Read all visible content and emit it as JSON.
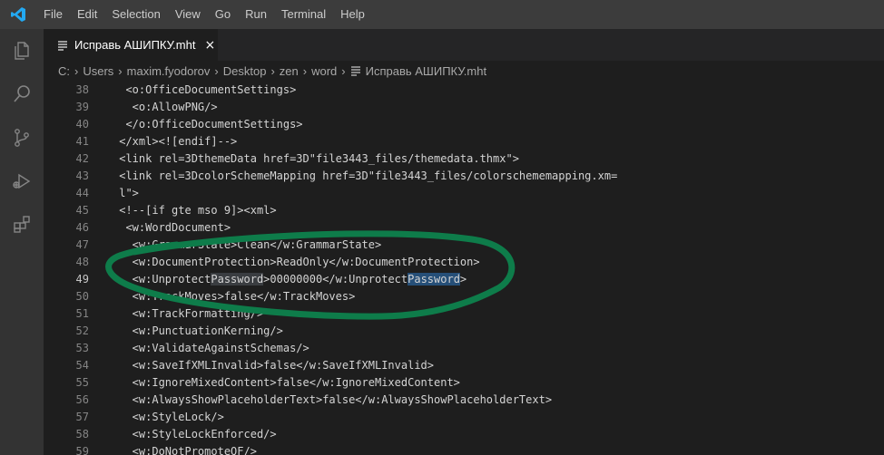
{
  "menu": [
    "File",
    "Edit",
    "Selection",
    "View",
    "Go",
    "Run",
    "Terminal",
    "Help"
  ],
  "tab": {
    "label": "Исправь АШИПКУ.mht",
    "close": "×"
  },
  "breadcrumb": [
    "C:",
    "Users",
    "maxim.fyodorov",
    "Desktop",
    "zen",
    "word",
    "Исправь АШИПКУ.mht"
  ],
  "editor": {
    "active_line": 49,
    "lines": [
      {
        "n": "38",
        "text": "  <o:OfficeDocumentSettings>"
      },
      {
        "n": "39",
        "text": "   <o:AllowPNG/>"
      },
      {
        "n": "40",
        "text": "  </o:OfficeDocumentSettings>"
      },
      {
        "n": "41",
        "text": " </xml><![endif]-->"
      },
      {
        "n": "42",
        "text": " <link rel=3DthemeData href=3D\"file3443_files/themedata.thmx\">"
      },
      {
        "n": "43",
        "text": " <link rel=3DcolorSchemeMapping href=3D\"file3443_files/colorschememapping.xm="
      },
      {
        "n": "44",
        "text": " l\">"
      },
      {
        "n": "45",
        "text": " <!--[if gte mso 9]><xml>"
      },
      {
        "n": "46",
        "text": "  <w:WordDocument>"
      },
      {
        "n": "47",
        "text": "   <w:GrammarState>Clean</w:GrammarState>"
      },
      {
        "n": "48",
        "text": "   <w:DocumentProtection>ReadOnly</w:DocumentProtection>"
      },
      {
        "n": "49",
        "text": "   <w:UnprotectPassword>00000000</w:UnprotectPassword>"
      },
      {
        "n": "50",
        "text": "   <w:TrackMoves>false</w:TrackMoves>"
      },
      {
        "n": "51",
        "text": "   <w:TrackFormatting/>"
      },
      {
        "n": "52",
        "text": "   <w:PunctuationKerning/>"
      },
      {
        "n": "53",
        "text": "   <w:ValidateAgainstSchemas/>"
      },
      {
        "n": "54",
        "text": "   <w:SaveIfXMLInvalid>false</w:SaveIfXMLInvalid>"
      },
      {
        "n": "55",
        "text": "   <w:IgnoreMixedContent>false</w:IgnoreMixedContent>"
      },
      {
        "n": "56",
        "text": "   <w:AlwaysShowPlaceholderText>false</w:AlwaysShowPlaceholderText>"
      },
      {
        "n": "57",
        "text": "   <w:StyleLock/>"
      },
      {
        "n": "58",
        "text": "   <w:StyleLockEnforced/>"
      },
      {
        "n": "59",
        "text": "   <w:DoNotPromoteQF/>"
      }
    ],
    "line49_highlight": {
      "before": "   <w:Unprotect",
      "word1": "Password",
      "middle": ">00000000</w:Unprotect",
      "word2": "Password",
      "after": ">"
    }
  },
  "icons": [
    "vscode-logo-icon",
    "explorer-icon",
    "search-icon",
    "source-control-icon",
    "run-debug-icon",
    "extensions-icon",
    "file-icon",
    "close-icon",
    "chevron-right-icon"
  ],
  "colors": {
    "annotation": "#0e7c4a",
    "titlebar": "#3c3c3c",
    "activitybar": "#333333",
    "editor_bg": "#1e1e1e",
    "accent": "#0078d4"
  }
}
